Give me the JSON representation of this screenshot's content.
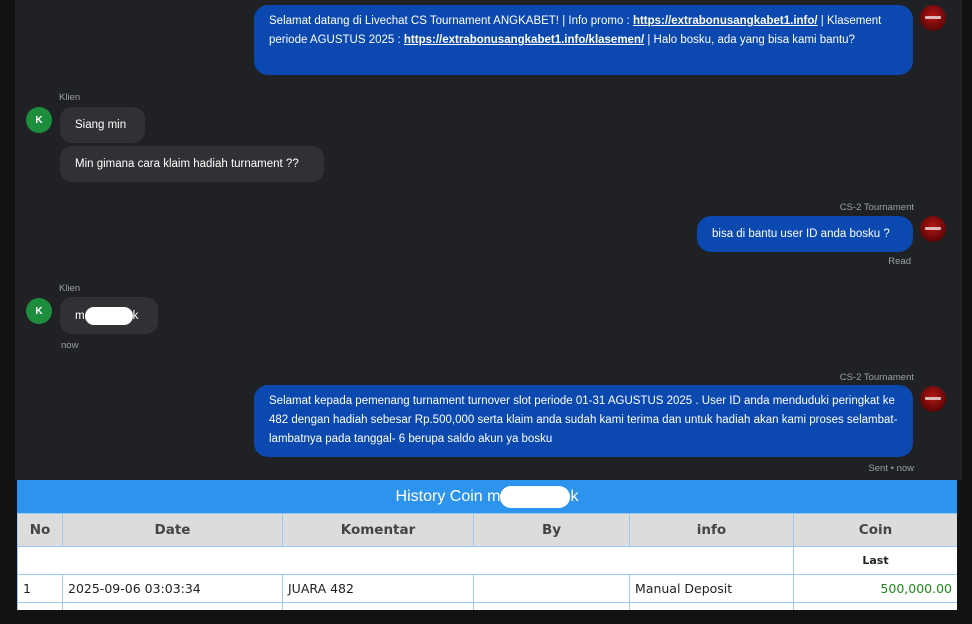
{
  "messages": {
    "m1": {
      "part1": "Selamat datang di Livechat CS Tournament ANGKABET! | Info promo : ",
      "link1": "https://extrabonusangkabet1.info/",
      "part2": " | Klasement periode AGUSTUS 2025 : ",
      "link2": "https://extrabonusangkabet1.info/klasemen/",
      "part3": " | Halo bosku, ada yang bisa kami bantu?"
    },
    "client_label": "Klien",
    "client_avatar": "K",
    "m2": "Siang min",
    "m3": "Min gimana cara klaim hadiah turnament ??",
    "agent_label": "CS-2 Tournament",
    "m4": "bisa di bantu user ID anda bosku ?",
    "m4_status": "Read",
    "m5_prefix": "m",
    "m5_suffix": "k",
    "m5_time": "now",
    "m6": "Selamat kepada pemenang turnament turnover slot periode 01-31 AGUSTUS 2025 . User ID anda menduduki peringkat ke 482 dengan hadiah sebesar Rp.500,000 serta klaim anda sudah kami terima dan untuk hadiah akan kami proses selambat-lambatnya pada tanggal- 6 berupa saldo akun ya bosku",
    "m6_status": "Sent • now"
  },
  "history": {
    "title_prefix": "History Coin m",
    "title_suffix": "k",
    "columns": [
      "No",
      "Date",
      "Komentar",
      "By",
      "info",
      "Coin"
    ],
    "sub_label": "Last",
    "rows": [
      {
        "no": "1",
        "date": "2025-09-06 03:03:34",
        "komentar": "JUARA 482",
        "by": "",
        "info": "Manual Deposit",
        "coin": "500,000.00"
      }
    ]
  },
  "colors": {
    "agent_bubble": "#0b49b0",
    "client_bubble": "#303134",
    "header_bar": "#2d94ee",
    "coin_positive": "#1e8a1e"
  },
  "icons": {
    "agent_avatar": "cs-logo-icon",
    "client_avatar": "user-initial-avatar"
  }
}
